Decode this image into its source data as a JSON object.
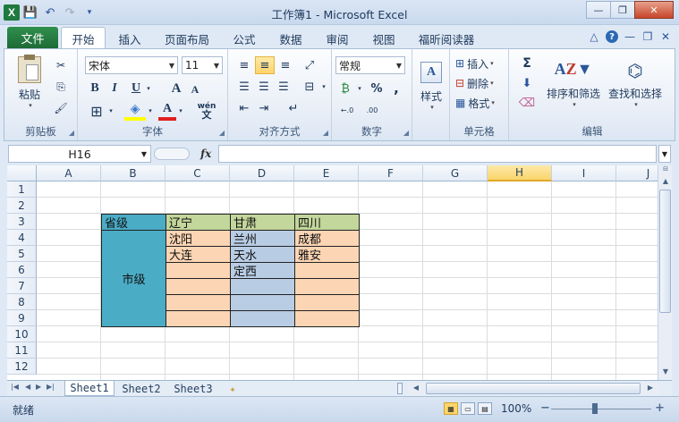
{
  "window": {
    "title": "工作簿1 - Microsoft Excel",
    "app_icon": "X"
  },
  "qat": {
    "save_icon": "💾",
    "undo_icon": "↶",
    "redo_icon": "↷",
    "customize_icon": "▾"
  },
  "window_controls": {
    "minimize": "—",
    "restore": "❐",
    "close": "✕"
  },
  "tabs": {
    "file": "文件",
    "items": [
      "开始",
      "插入",
      "页面布局",
      "公式",
      "数据",
      "审阅",
      "视图",
      "福昕阅读器"
    ],
    "active": "开始"
  },
  "tab_right": {
    "collapse": "△",
    "help": "?",
    "min": "—",
    "restore": "❐",
    "close": "✕"
  },
  "ribbon": {
    "clipboard": {
      "label": "剪贴板",
      "paste": "粘贴",
      "cut": "✂",
      "copy": "⎘",
      "format_painter": "🖌"
    },
    "font": {
      "label": "字体",
      "name": "宋体",
      "size": "11",
      "bold": "B",
      "italic": "I",
      "underline": "U",
      "grow": "A",
      "shrink": "A",
      "border": "⊞",
      "fill": "◈",
      "color": "A",
      "wen": "wén"
    },
    "alignment": {
      "label": "对齐方式"
    },
    "number": {
      "label": "数字",
      "format": "常规",
      "percent": "%",
      "comma": ",",
      "inc_decimal": "←.0",
      "dec_decimal": ".00"
    },
    "styles": {
      "label": "样式",
      "button": "样式"
    },
    "cells": {
      "label": "单元格",
      "insert": "插入",
      "delete": "删除",
      "format": "格式"
    },
    "editing": {
      "label": "编辑",
      "sum": "Σ",
      "sort_filter": "排序和筛选",
      "find_select": "查找和选择"
    }
  },
  "formula_bar": {
    "name_box": "H16",
    "fx": "fx",
    "formula": ""
  },
  "grid": {
    "columns": [
      "A",
      "B",
      "C",
      "D",
      "E",
      "F",
      "G",
      "H",
      "I",
      "J"
    ],
    "highlighted_column": "H",
    "rows": [
      "1",
      "2",
      "3",
      "4",
      "5",
      "6",
      "7",
      "8",
      "9",
      "10",
      "11",
      "12"
    ],
    "cells": {
      "B3": "省级",
      "C3": "辽宁",
      "D3": "甘肃",
      "E3": "四川",
      "B4_merged": "市级",
      "C4": "沈阳",
      "D4": "兰州",
      "E4": "成都",
      "C5": "大连",
      "D5": "天水",
      "E5": "雅安",
      "D6": "定西"
    },
    "colors": {
      "teal": "#4bacc6",
      "green": "#c3d69b",
      "peach": "#fcd5b4",
      "blue": "#b8cce4"
    }
  },
  "sheets": {
    "tabs": [
      "Sheet1",
      "Sheet2",
      "Sheet3"
    ],
    "active": "Sheet1"
  },
  "status": {
    "ready": "就绪",
    "zoom": "100%",
    "zoom_out": "−",
    "zoom_in": "+"
  }
}
